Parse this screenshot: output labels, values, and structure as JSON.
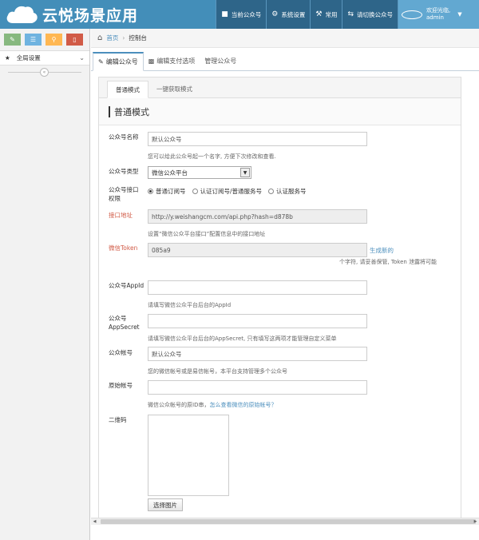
{
  "app": {
    "brand": "云悦场景应用"
  },
  "nav": {
    "current_account": "当前公众号",
    "system_settings": "系统设置",
    "common": "常用",
    "switch_account": "请切换公众号",
    "welcome": "欢迎光临,",
    "username": "admin"
  },
  "sidebar": {
    "global_settings": "全局设置"
  },
  "breadcrumb": {
    "home": "首页",
    "current": "控制台"
  },
  "tabs": [
    "编辑公众号",
    "编辑支付选项",
    "管理公众号"
  ],
  "subtabs": [
    "普通模式",
    "一键获取模式"
  ],
  "section_title": "普通模式",
  "form": {
    "name_label": "公众号名称",
    "name_value": "默认公众号",
    "name_help": "您可以给此公众号起一个名字, 方便下次修改和查看.",
    "type_label": "公众号类型",
    "type_value": "微信公众平台",
    "iface_label_1": "公众号接口",
    "iface_label_2": "权限",
    "radio_1": "普通订阅号",
    "radio_2": "认证订阅号/普通服务号",
    "radio_3": "认证服务号",
    "api_label": "接口地址",
    "api_value": "http://y.weishangcm.com/api.php?hash=d878b",
    "api_help": "设置“微信公众平台接口”配置信息中的接口地址",
    "token_label": "微信Token",
    "token_value": "085a9",
    "token_gen": "生成新的",
    "token_help": "个字符, 请妥善保管, Token 泄露将可能",
    "appid_label": "公众号AppId",
    "appid_help": "请填写微信公众平台后台的AppId",
    "secret_label_1": "公众号",
    "secret_label_2": "AppSecret",
    "secret_help": "请填写微信公众平台后台的AppSecret, 只有填写这两项才能管理自定义菜单",
    "account_label": "公众帐号",
    "account_value": "默认公众号",
    "account_help": "您的微信帐号或是易信帐号，本平台支持管理多个公众号",
    "origin_label": "原始帐号",
    "origin_help_text": "微信公众帐号的原ID串，",
    "origin_help_link": "怎么查看微信的原始帐号？",
    "qr_label": "二维码",
    "choose_image": "选择图片"
  }
}
